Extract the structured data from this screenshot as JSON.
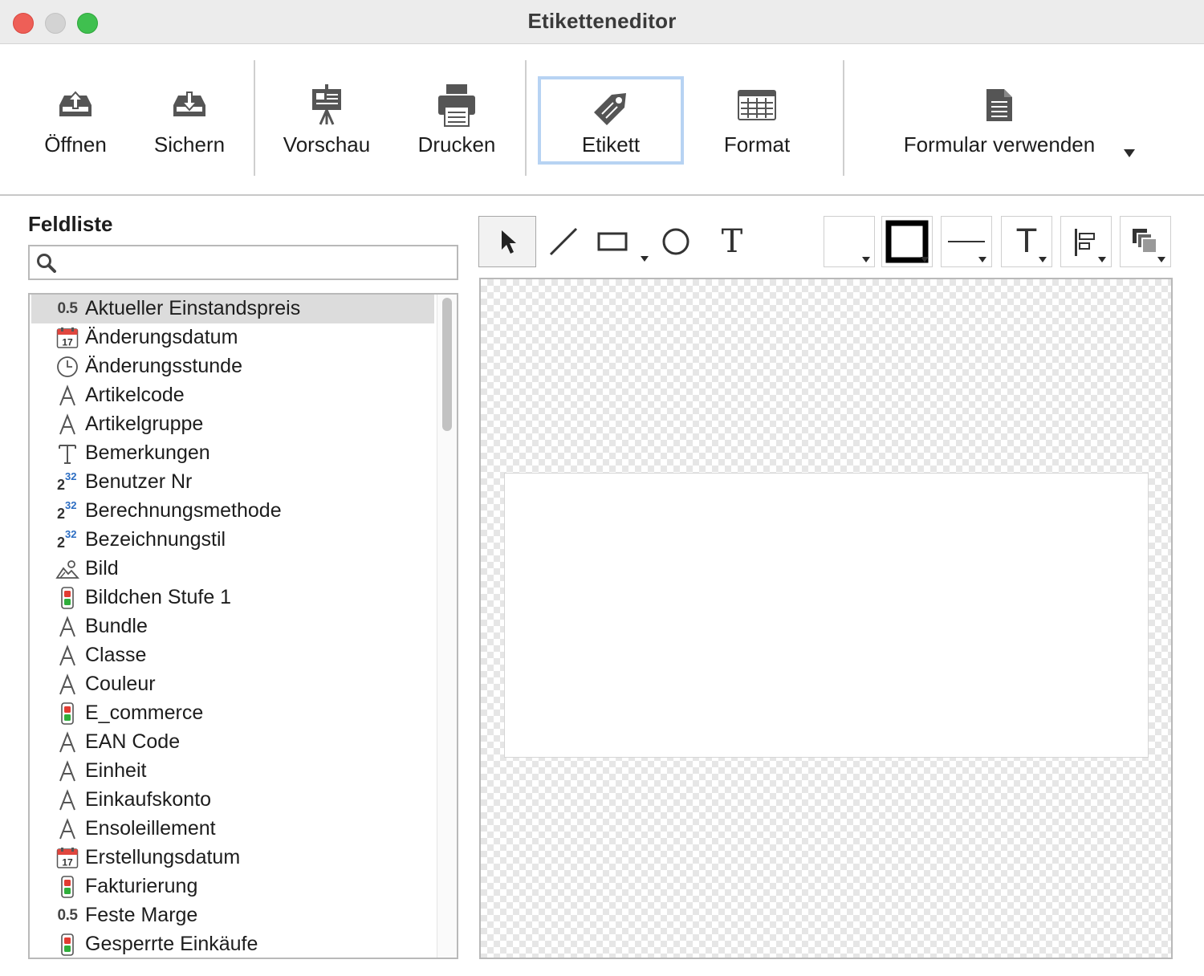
{
  "window": {
    "title": "Etiketteneditor"
  },
  "toolbar": {
    "open_label": "Öffnen",
    "save_label": "Sichern",
    "preview_label": "Vorschau",
    "print_label": "Drucken",
    "label_label": "Etikett",
    "format_label": "Format",
    "form_label": "Formular verwenden",
    "active": "Etikett"
  },
  "field_list": {
    "title": "Feldliste",
    "search_value": "",
    "items": [
      {
        "label": "Aktueller Einstandspreis",
        "icon": "decimal-icon",
        "selected": true
      },
      {
        "label": "Änderungsdatum",
        "icon": "calendar-icon"
      },
      {
        "label": "Änderungsstunde",
        "icon": "clock-icon"
      },
      {
        "label": "Artikelcode",
        "icon": "alpha-icon"
      },
      {
        "label": "Artikelgruppe",
        "icon": "alpha-icon"
      },
      {
        "label": "Bemerkungen",
        "icon": "text-icon"
      },
      {
        "label": "Benutzer Nr",
        "icon": "integer-icon"
      },
      {
        "label": "Berechnungsmethode",
        "icon": "integer-icon"
      },
      {
        "label": "Bezeichnungstil",
        "icon": "integer-icon"
      },
      {
        "label": "Bild",
        "icon": "picture-icon"
      },
      {
        "label": "Bildchen Stufe 1",
        "icon": "boolean-icon"
      },
      {
        "label": "Bundle",
        "icon": "alpha-icon"
      },
      {
        "label": "Classe",
        "icon": "alpha-icon"
      },
      {
        "label": "Couleur",
        "icon": "alpha-icon"
      },
      {
        "label": "E_commerce",
        "icon": "boolean-icon"
      },
      {
        "label": "EAN Code",
        "icon": "alpha-icon"
      },
      {
        "label": "Einheit",
        "icon": "alpha-icon"
      },
      {
        "label": "Einkaufskonto",
        "icon": "alpha-icon"
      },
      {
        "label": "Ensoleillement",
        "icon": "alpha-icon"
      },
      {
        "label": "Erstellungsdatum",
        "icon": "calendar-icon"
      },
      {
        "label": "Fakturierung",
        "icon": "boolean-icon"
      },
      {
        "label": "Feste Marge",
        "icon": "decimal-icon"
      },
      {
        "label": "Gesperrte Einkäufe",
        "icon": "boolean-icon"
      }
    ],
    "icon_text": {
      "decimal": "0.5",
      "calendar_day": "17",
      "integer_base": "2",
      "integer_exp": "32"
    }
  },
  "drawing_tools": {
    "text_tool_glyph": "T",
    "text_style_glyph": "T",
    "selected": "pointer"
  },
  "colors": {
    "active_border": "#b7d3f3",
    "selection": "#dcdcdc"
  }
}
